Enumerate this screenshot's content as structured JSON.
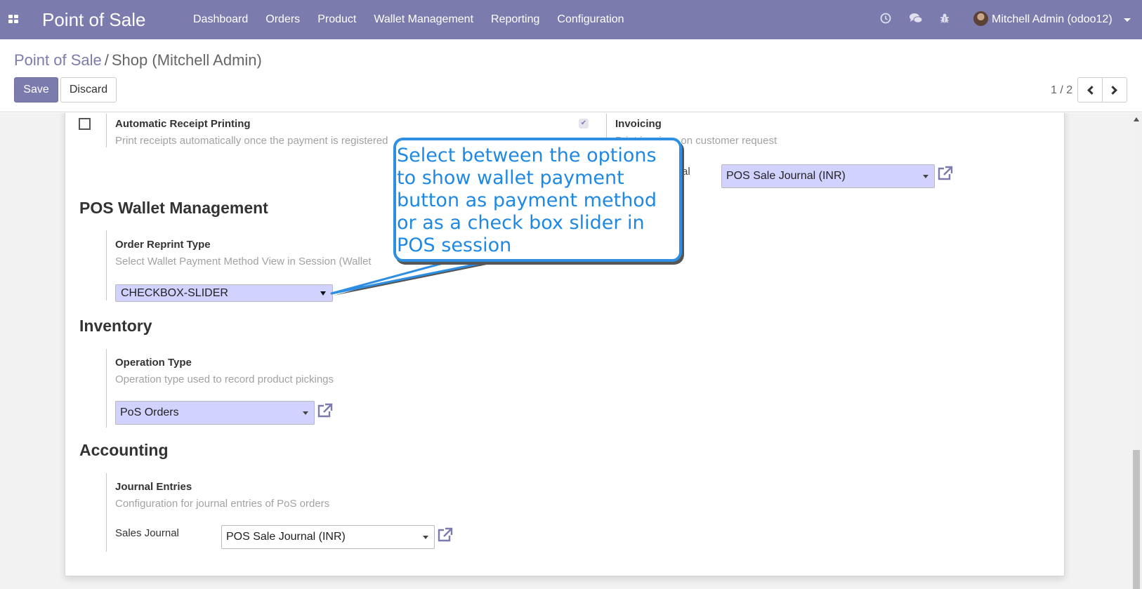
{
  "navbar": {
    "app_title": "Point of Sale",
    "menu": [
      "Dashboard",
      "Orders",
      "Product",
      "Wallet Management",
      "Reporting",
      "Configuration"
    ],
    "user": "Mitchell Admin (odoo12)",
    "icons": [
      "apps-icon",
      "clock-icon",
      "chat-icon",
      "bug-icon",
      "avatar",
      "caret-down-icon"
    ]
  },
  "breadcrumb": {
    "parent": "Point of Sale",
    "separator": "/",
    "current": "Shop (Mitchell Admin)"
  },
  "buttons": {
    "save": "Save",
    "discard": "Discard"
  },
  "pager": {
    "value": "1 / 2"
  },
  "form": {
    "receipt": {
      "label": "Automatic Receipt Printing",
      "help": "Print receipts automatically once the payment is registered",
      "checked": false
    },
    "invoicing": {
      "label": "Invoicing",
      "help": "Print invoices on customer request",
      "journal_label_partial": "al",
      "journal_value": "POS Sale Journal (INR)",
      "checked": true
    },
    "wallet_section": {
      "title": "POS Wallet Management",
      "field_label": "Order Reprint Type",
      "help": "Select Wallet Payment Method View in Session (Wallet",
      "value": "CHECKBOX-SLIDER"
    },
    "inventory_section": {
      "title": "Inventory",
      "field_label": "Operation Type",
      "help": "Operation type used to record product pickings",
      "value": "PoS Orders"
    },
    "accounting_section": {
      "title": "Accounting",
      "field_label": "Journal Entries",
      "help": "Configuration for journal entries of PoS orders",
      "sales_journal_label": "Sales Journal",
      "sales_journal_value": "POS Sale Journal (INR)"
    }
  },
  "callout": {
    "text": "Select between the options to show wallet payment button as payment method or as a check box slider in POS session"
  },
  "colors": {
    "brand": "#7c7bad",
    "required_field": "#d2d2ff",
    "callout": "#1e88e5"
  }
}
